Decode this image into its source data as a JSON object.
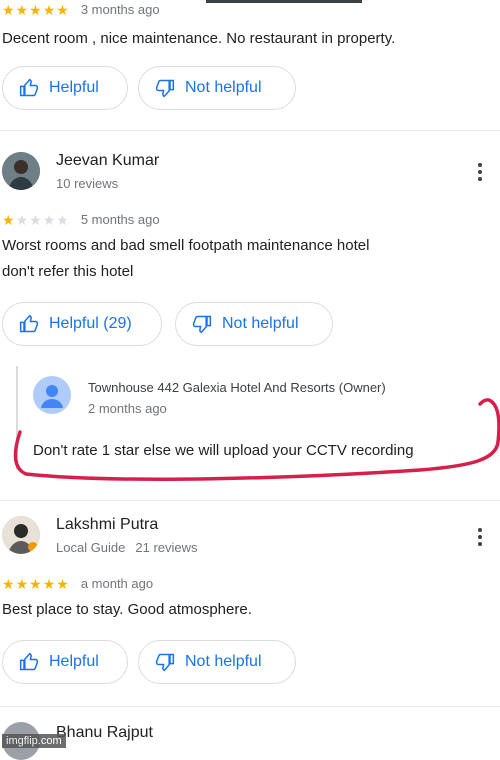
{
  "review0": {
    "rating": 5,
    "ago": "3 months ago",
    "text": "Decent room , nice maintenance. No restaurant in property.",
    "helpful_label": "Helpful",
    "not_helpful_label": "Not helpful"
  },
  "review1": {
    "name": "Jeevan Kumar",
    "meta": "10 reviews",
    "rating": 1,
    "ago": "5 months ago",
    "text_line1": "Worst rooms and bad smell footpath maintenance hotel",
    "text_line2": "don't refer this hotel",
    "helpful_label": "Helpful (29)",
    "not_helpful_label": "Not helpful",
    "owner_reply": {
      "name": "Townhouse 442 Galexia Hotel And Resorts (Owner)",
      "ago": "2 months ago",
      "text": "Don't rate 1 star else we will upload your CCTV recording"
    }
  },
  "review2": {
    "name": "Lakshmi Putra",
    "meta_guide": "Local Guide",
    "meta_reviews": "21 reviews",
    "rating": 5,
    "ago": "a month ago",
    "text": "Best place to stay. Good atmosphere.",
    "helpful_label": "Helpful",
    "not_helpful_label": "Not helpful"
  },
  "review3": {
    "name": "Bhanu Rajput"
  },
  "annotation_color": "#d6204c",
  "watermark": "imgflip.com"
}
